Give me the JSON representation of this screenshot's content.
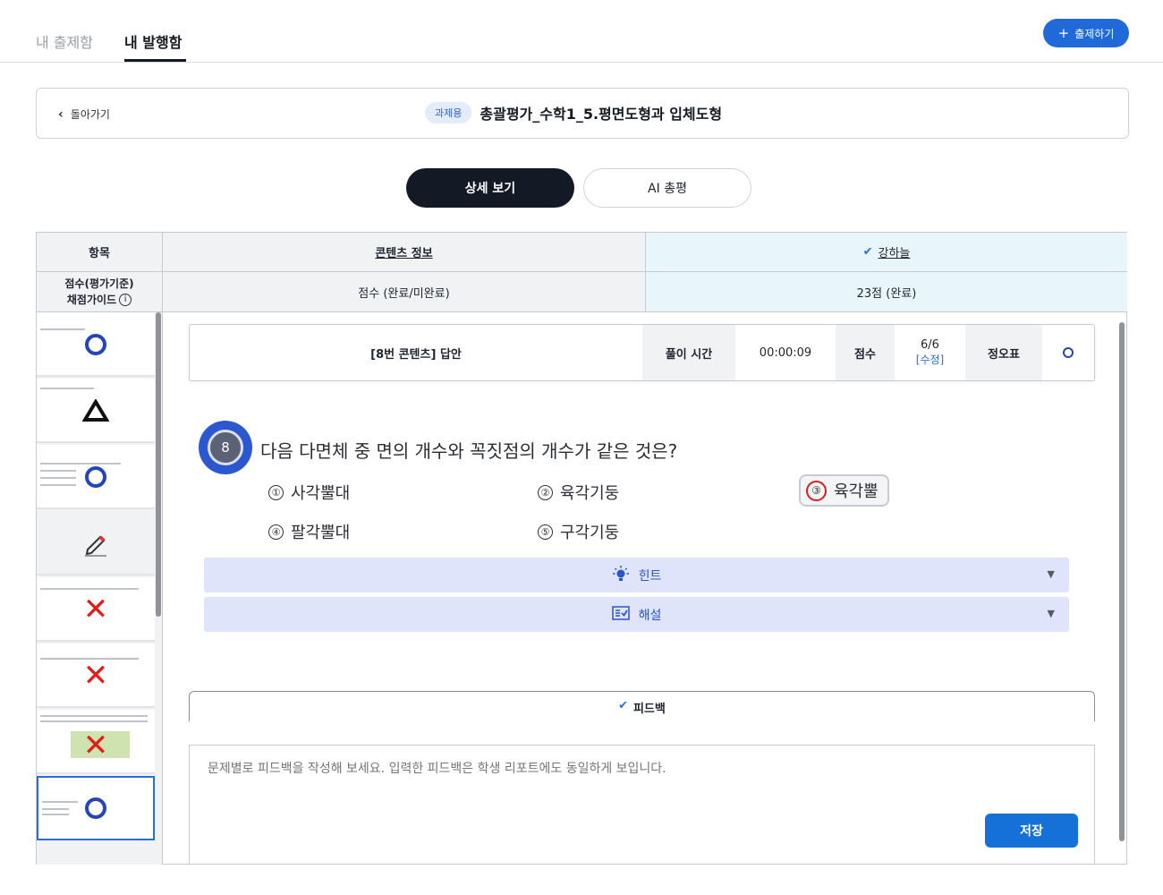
{
  "nav": {
    "tab_drafts": "내 출제함",
    "tab_published": "내 발행함",
    "create_button": "출제하기"
  },
  "header": {
    "back_label": "돌아가기",
    "badge": "과제용",
    "title": "총괄평가_수학1_5.평면도형과 입체도형"
  },
  "view_toggle": {
    "detail": "상세 보기",
    "ai_review": "AI 총평"
  },
  "table": {
    "col_item": "항목",
    "col_content": "콘텐츠 정보",
    "student_name": "강하늘",
    "row_label_line1": "점수(평가기준)",
    "row_label_line2": "채점가이드",
    "score_header": "점수 (완료/미완료)",
    "student_score": "23점 (완료)"
  },
  "thumbnails": [
    {
      "result": "correct",
      "icon": "o-mark-icon"
    },
    {
      "result": "partial",
      "icon": "triangle-mark-icon"
    },
    {
      "result": "correct",
      "icon": "o-mark-icon"
    },
    {
      "result": "pending",
      "icon": "pencil-icon"
    },
    {
      "result": "wrong",
      "icon": "x-mark-icon"
    },
    {
      "result": "wrong",
      "icon": "x-mark-icon"
    },
    {
      "result": "wrong",
      "icon": "x-mark-icon"
    },
    {
      "result": "correct",
      "icon": "o-mark-icon",
      "selected": true
    }
  ],
  "answer_bar": {
    "title": "[8번 콘텐츠] 답안",
    "time_label": "풀이 시간",
    "time_value": "00:00:09",
    "score_label": "점수",
    "score_value": "6/6",
    "edit_label": "[수정]",
    "result_label": "정오표"
  },
  "question": {
    "number": "8",
    "text": "다음 다면체 중 면의 개수와 꼭짓점의 개수가 같은 것은?",
    "options": [
      {
        "num": "①",
        "label": "사각뿔대"
      },
      {
        "num": "②",
        "label": "육각기둥"
      },
      {
        "num": "③",
        "label": "육각뿔"
      },
      {
        "num": "④",
        "label": "팔각뿔대"
      },
      {
        "num": "⑤",
        "label": "구각기둥"
      }
    ],
    "selected_option": 3
  },
  "accordions": {
    "hint": "힌트",
    "explanation": "해설"
  },
  "feedback": {
    "tab_label": "피드백",
    "placeholder": "문제별로 피드백을 작성해 보세요. 입력한 피드백은 학생 리포트에도 동일하게 보입니다.",
    "save": "저장"
  },
  "colors": {
    "primary": "#1f6ad8",
    "dark_button": "#141a25",
    "correct_mark": "#2545b8",
    "wrong_mark": "#e21b1b",
    "accordion_bg": "#dfe4fb"
  }
}
